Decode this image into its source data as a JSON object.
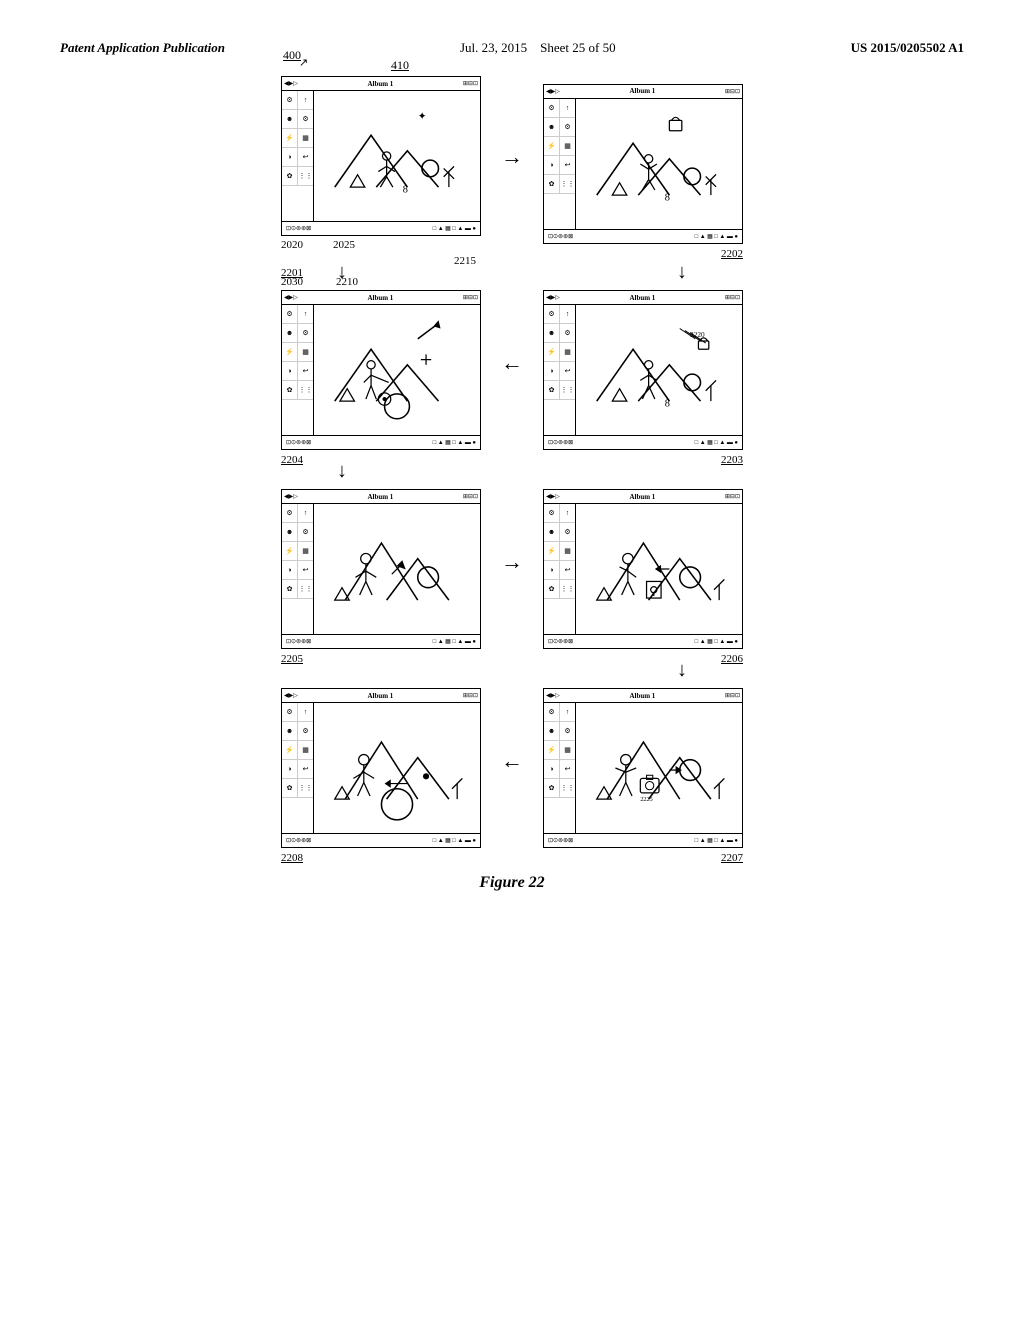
{
  "header": {
    "left": "Patent Application Publication",
    "center": "Jul. 23, 2015",
    "sheet": "Sheet 25 of 50",
    "right": "US 2015/0205502 A1"
  },
  "figure": {
    "caption": "Figure 22",
    "main_label": "400",
    "label_410": "410",
    "label_2020": "2020",
    "label_2025": "2025",
    "label_2215": "2215",
    "label_2030": "2030",
    "label_2210": "2210",
    "label_2201": "2201",
    "label_2202": "2202",
    "label_2203": "2203",
    "label_2204": "2204",
    "label_2205": "2205",
    "label_2206": "2206",
    "label_2207": "2207",
    "label_2208": "2208",
    "label_2220": "2220",
    "label_2225": "2225"
  },
  "device": {
    "album_title": "Album 1",
    "topbar_left_icons": "◀▶▷",
    "topbar_right_icons": "⊞⊟⊠⊡"
  }
}
